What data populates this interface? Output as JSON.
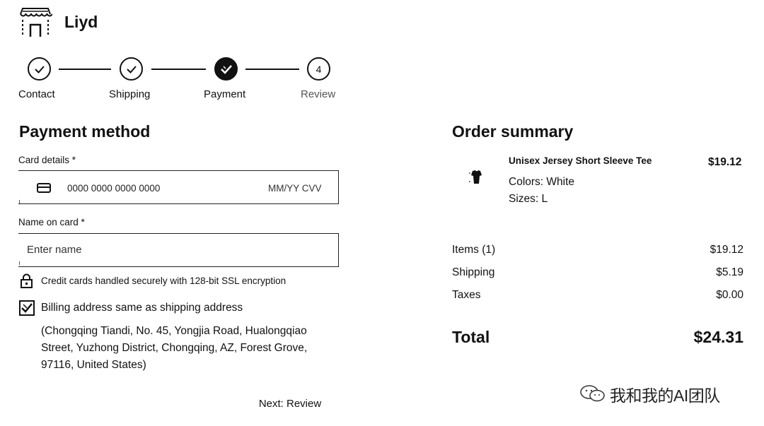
{
  "header": {
    "brand": "Liyd",
    "logo_icon": "storefront-icon"
  },
  "stepper": {
    "steps": [
      {
        "label": "Contact",
        "state": "complete",
        "icon": "check-icon"
      },
      {
        "label": "Shipping",
        "state": "complete",
        "icon": "check-icon"
      },
      {
        "label": "Payment",
        "state": "current",
        "icon": "check-icon"
      },
      {
        "label": "Review",
        "state": "pending",
        "number": "4"
      }
    ]
  },
  "payment": {
    "title": "Payment method",
    "card_label": "Card details *",
    "card_number_placeholder": "0000 0000 0000 0000",
    "card_exp_placeholder": "MM/YY CVV",
    "name_label": "Name on card *",
    "name_placeholder": "Enter name",
    "ssl_note": "Credit cards handled securely with 128-bit SSL encryption",
    "billing_same_label": "Billing address same as shipping address",
    "billing_same_checked": true,
    "billing_address": "(Chongqing Tiandi, No. 45, Yongjia Road, Hualongqiao Street, Yuzhong District, Chongqing, AZ, Forest Grove, 97116, United States)",
    "next_button": "Next: Review"
  },
  "summary": {
    "title": "Order summary",
    "item": {
      "name": "Unisex Jersey Short Sleeve Tee",
      "price": "$19.12",
      "color": "Colors: White",
      "size": "Sizes: L"
    },
    "items_label": "Items (1)",
    "items_value": "$19.12",
    "shipping_label": "Shipping",
    "shipping_value": "$5.19",
    "taxes_label": "Taxes",
    "taxes_value": "$0.00",
    "total_label": "Total",
    "total_value": "$24.31"
  },
  "watermark": {
    "text": "我和我的AI团队",
    "icon": "wechat-icon"
  },
  "colors": {
    "ink": "#111111",
    "background": "#ffffff"
  }
}
